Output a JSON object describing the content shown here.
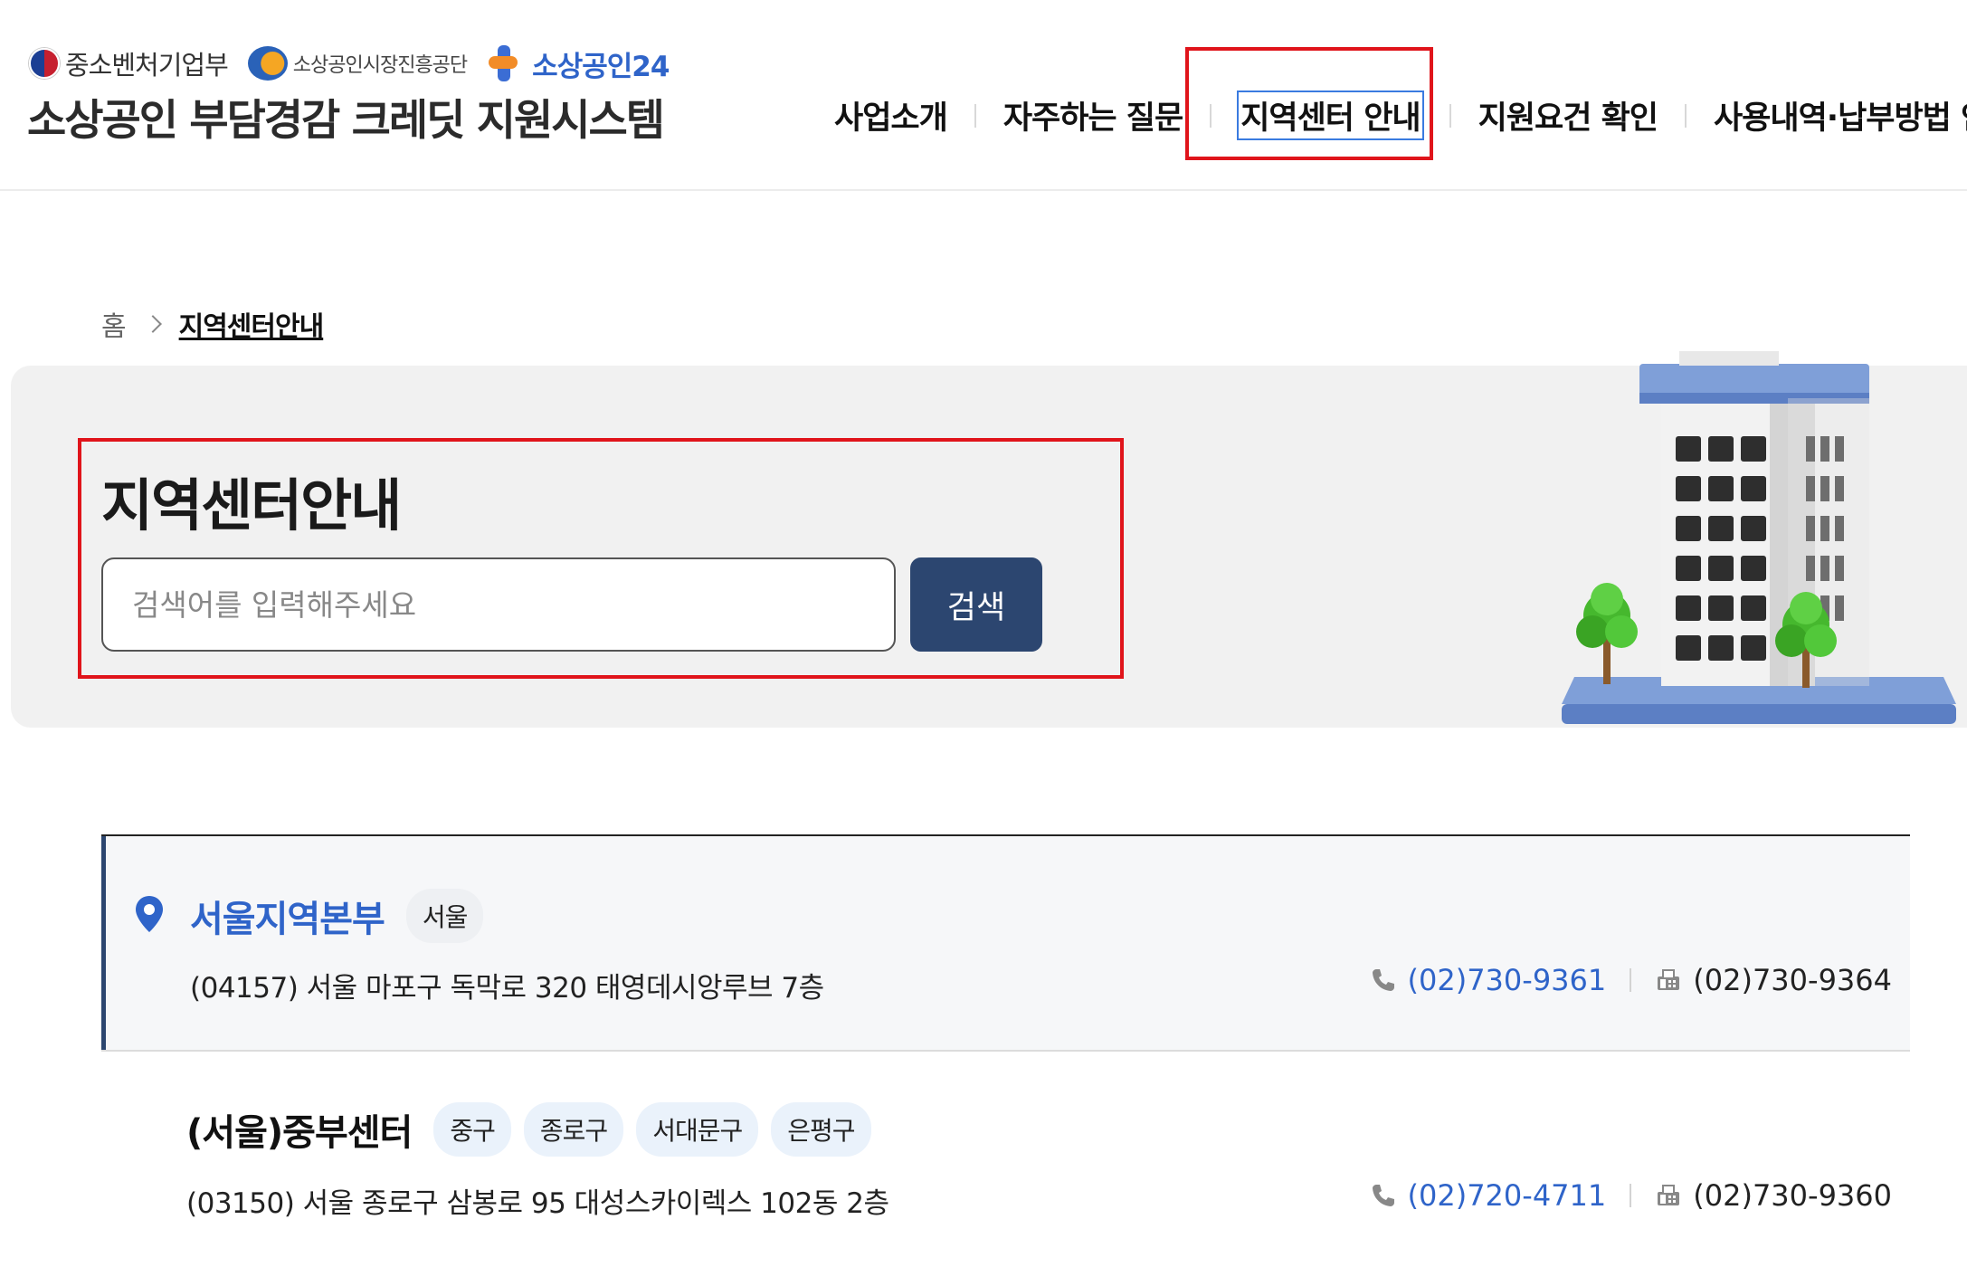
{
  "header": {
    "logos": {
      "ministry": "중소벤처기업부",
      "semas": "소상공인시장진흥공단",
      "s24": "소상공인24"
    },
    "site_title": "소상공인 부담경감 크레딧 지원시스템",
    "nav": [
      {
        "label": "사업소개"
      },
      {
        "label": "자주하는 질문"
      },
      {
        "label": "지역센터 안내",
        "current": true
      },
      {
        "label": "지원요건 확인"
      },
      {
        "label": "사용내역·납부방법 안내"
      }
    ]
  },
  "breadcrumb": {
    "home": "홈",
    "current": "지역센터안내"
  },
  "hero": {
    "title": "지역센터안내",
    "search_placeholder": "검색어를 입력해주세요",
    "search_button": "검색"
  },
  "centers": [
    {
      "name": "서울지역본부",
      "tags": [
        "서울"
      ],
      "address": "(04157) 서울 마포구 독막로 320 태영데시앙루브 7층",
      "phone": "(02)730-9361",
      "fax": "(02)730-9364"
    },
    {
      "name": "(서울)중부센터",
      "tags": [
        "중구",
        "종로구",
        "서대문구",
        "은평구"
      ],
      "address": "(03150) 서울 종로구 삼봉로 95 대성스카이렉스 102동 2층",
      "phone": "(02)720-4711",
      "fax": "(02)730-9360"
    }
  ],
  "colors": {
    "accent_blue": "#2f64c9",
    "search_button": "#2c4670",
    "highlight_red": "#e0141b"
  },
  "icons": {
    "pin": "location-pin-icon",
    "phone": "phone-icon",
    "fax": "fax-icon",
    "breadcrumb_sep": "chevron-right-icon"
  }
}
